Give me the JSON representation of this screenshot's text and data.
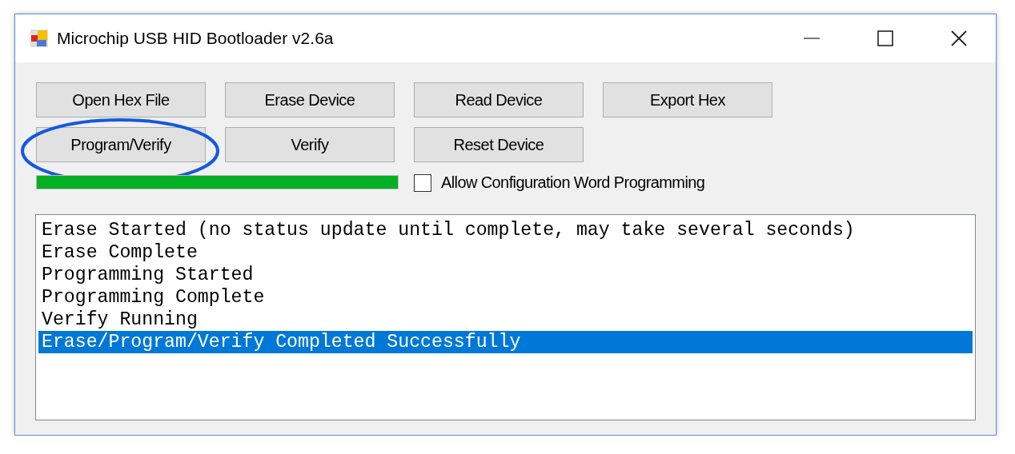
{
  "window": {
    "title": "Microchip USB HID Bootloader v2.6a"
  },
  "button_rows": [
    [
      {
        "label": "Open Hex File",
        "circled": false
      },
      {
        "label": "Erase Device",
        "circled": false
      },
      {
        "label": "Read Device",
        "circled": false
      },
      {
        "label": "Export Hex",
        "circled": false
      }
    ],
    [
      {
        "label": "Program/Verify",
        "circled": true
      },
      {
        "label": "Verify",
        "circled": false
      },
      {
        "label": "Reset Device",
        "circled": false
      }
    ]
  ],
  "progress": {
    "level": 1
  },
  "checkbox": {
    "label": "Allow Configuration Word Programming",
    "checked": false
  },
  "log": [
    {
      "text": "Erase Started (no status update until complete, may take several seconds)",
      "selected": false
    },
    {
      "text": "Erase Complete",
      "selected": false
    },
    {
      "text": "Programming Started",
      "selected": false
    },
    {
      "text": "Programming Complete",
      "selected": false
    },
    {
      "text": "Verify Running",
      "selected": false
    },
    {
      "text": "Erase/Program/Verify Completed Successfully",
      "selected": true
    }
  ]
}
